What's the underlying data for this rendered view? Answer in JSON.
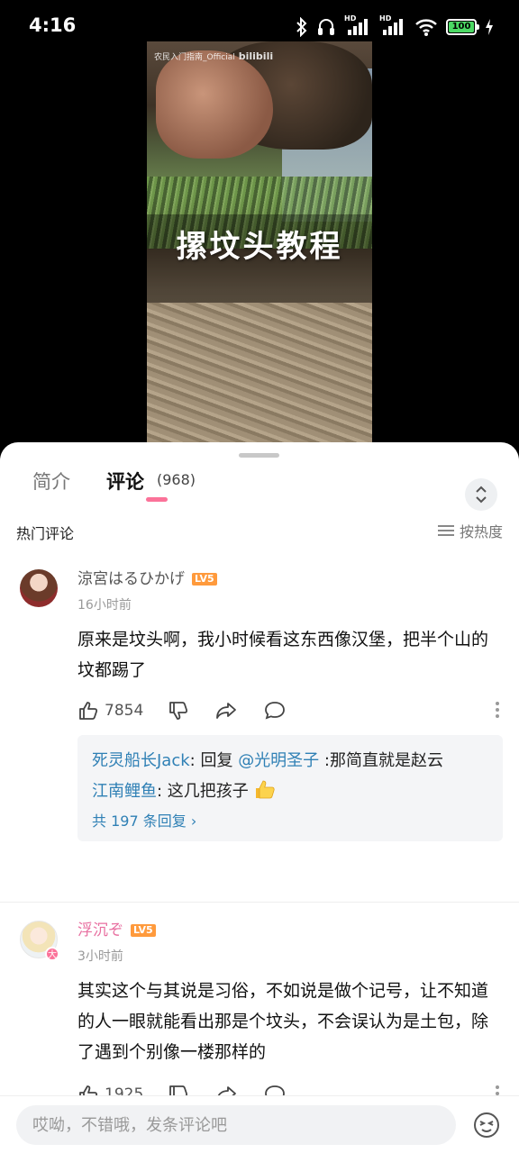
{
  "status_bar": {
    "time": "4:16",
    "battery": "100"
  },
  "video": {
    "watermark": "农民入门指南_Official",
    "watermark_logo": "bilibili",
    "caption": "摞坟头教程"
  },
  "tabs": {
    "intro": "简介",
    "comments": "评论",
    "comments_count": "(968)"
  },
  "comments_section": {
    "title": "热门评论",
    "sort_label": "按热度"
  },
  "comments": [
    {
      "username": "涼宮はるひかげ",
      "level": "LV5",
      "time": "16小时前",
      "text": "原来是坟头啊，我小时候看这东西像汉堡，把半个山的坟都踢了",
      "likes": "7854",
      "replies": [
        {
          "user": "死灵船长Jack",
          "prefix": ": 回复 ",
          "mention": "@光明圣子",
          "text": " :那简直就是赵云"
        },
        {
          "user": "江南鲤鱼",
          "prefix": ": ",
          "text": "这几把孩子"
        }
      ],
      "more_replies": "共 197 条回复"
    },
    {
      "username": "浮沉ぞ",
      "level": "LV5",
      "badge": "大",
      "time": "3小时前",
      "text": "其实这个与其说是习俗，不如说是做个记号，让不知道的人一眼就能看出那是个坟头，不会误认为是土包，除了遇到个别像一楼那样的",
      "likes": "1925"
    }
  ],
  "input": {
    "placeholder": "哎呦，不错哦，发条评论吧"
  },
  "colors": {
    "accent_pink": "#fb7299",
    "link_blue": "#2f80b5",
    "level_orange": "#ff9a3c"
  },
  "icons": [
    "bluetooth-icon",
    "headphones-icon",
    "signal-icon",
    "wifi-icon",
    "battery-icon",
    "charging-icon",
    "expand-icon",
    "sort-icon",
    "like-icon",
    "dislike-icon",
    "share-icon",
    "reply-icon",
    "more-icon",
    "emoji-icon"
  ]
}
